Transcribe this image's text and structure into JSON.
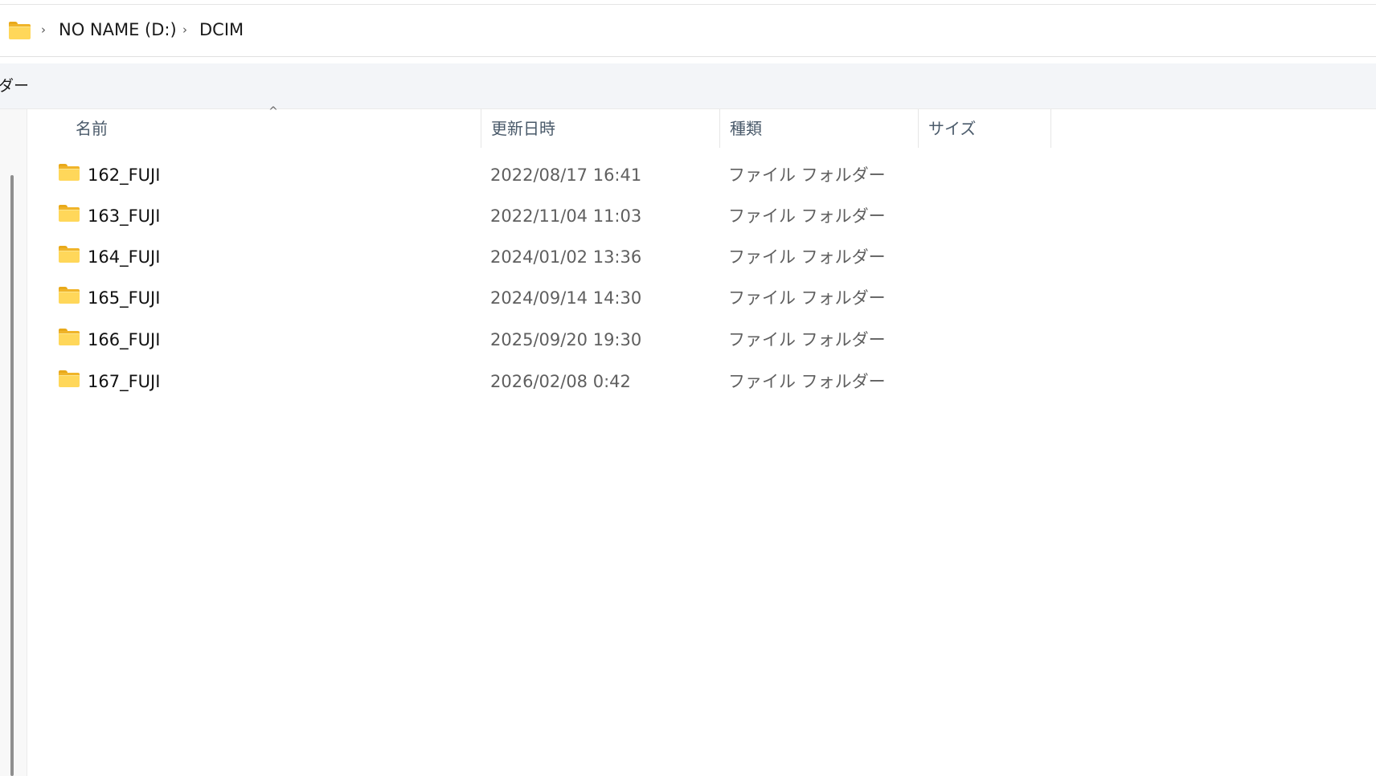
{
  "address_bar": {
    "crumbs": [
      "NO NAME (D:)",
      "DCIM"
    ]
  },
  "command_bar": {
    "partial_text": "ダー"
  },
  "columns": {
    "name": "名前",
    "modified": "更新日時",
    "type": "種類",
    "size": "サイズ"
  },
  "sort": {
    "column": "name",
    "indicator": "^"
  },
  "files": [
    {
      "name": "162_FUJI",
      "modified": "2022/08/17 16:41",
      "type": "ファイル フォルダー",
      "size": ""
    },
    {
      "name": "163_FUJI",
      "modified": "2022/11/04 11:03",
      "type": "ファイル フォルダー",
      "size": ""
    },
    {
      "name": "164_FUJI",
      "modified": "2024/01/02 13:36",
      "type": "ファイル フォルダー",
      "size": ""
    },
    {
      "name": "165_FUJI",
      "modified": "2024/09/14 14:30",
      "type": "ファイル フォルダー",
      "size": ""
    },
    {
      "name": "166_FUJI",
      "modified": "2025/09/20 19:30",
      "type": "ファイル フォルダー",
      "size": ""
    },
    {
      "name": "167_FUJI",
      "modified": "2026/02/08 0:42",
      "type": "ファイル フォルダー",
      "size": ""
    }
  ],
  "icons": {
    "folder": "folder-icon",
    "breadcrumb_separator": "chevron-right-icon"
  },
  "colors": {
    "folder_front": "#ffd75a",
    "folder_back": "#f0b429",
    "command_bar_bg": "#f3f5f8",
    "header_text": "#4a5a6a",
    "secondary_text": "#5f5f5f"
  }
}
